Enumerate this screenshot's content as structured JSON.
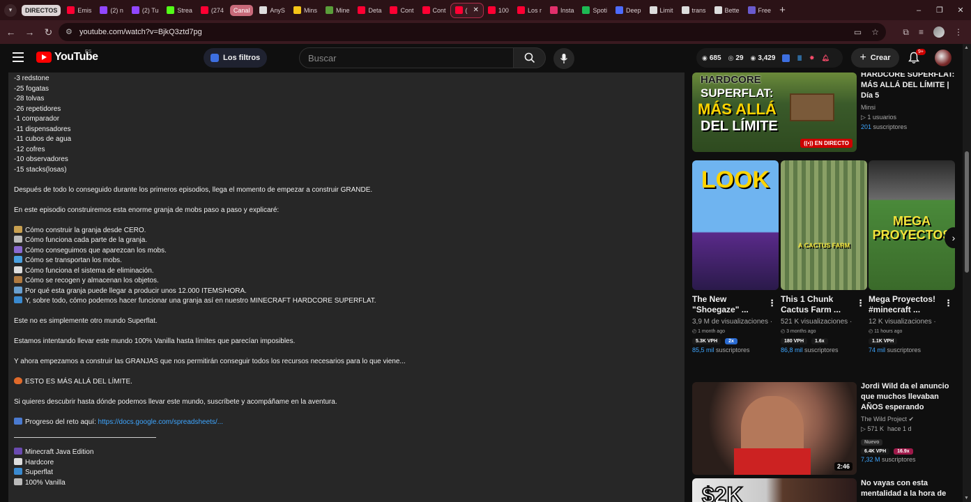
{
  "browser": {
    "tabs": [
      {
        "label": "DIRECTOS",
        "kind": "pill",
        "color": "#ddd5d6"
      },
      {
        "label": "Emis",
        "color": "#ff0033"
      },
      {
        "label": "(2) n",
        "color": "#9146ff"
      },
      {
        "label": "(2) Tu",
        "color": "#9146ff"
      },
      {
        "label": "Strea",
        "color": "#53fc18"
      },
      {
        "label": "(274",
        "color": "#ff0033"
      },
      {
        "label": "Canal",
        "kind": "pill-red",
        "color": "#c86a7a"
      },
      {
        "label": "AnyS",
        "color": "#dddddd"
      },
      {
        "label": "Mins",
        "color": "#f5c518"
      },
      {
        "label": "Mine",
        "color": "#5a9e3a"
      },
      {
        "label": "Deta",
        "color": "#ff0033"
      },
      {
        "label": "Cont",
        "color": "#ff0033"
      },
      {
        "label": "Cont",
        "color": "#ff0033"
      },
      {
        "label": "(",
        "kind": "active",
        "color": "#ff0033"
      },
      {
        "label": "100",
        "color": "#ff0033"
      },
      {
        "label": "Los r",
        "color": "#ff0033"
      },
      {
        "label": "Insta",
        "color": "#e1306c"
      },
      {
        "label": "Spoti",
        "color": "#1db954"
      },
      {
        "label": "Deep",
        "color": "#4d6bfe"
      },
      {
        "label": "Limit",
        "color": "#dddddd"
      },
      {
        "label": "trans",
        "color": "#dddddd"
      },
      {
        "label": "Bette",
        "color": "#dddddd"
      },
      {
        "label": "Free",
        "color": "#6a5acd"
      }
    ],
    "url": "youtube.com/watch?v=BjkQ3ztd7pg"
  },
  "masthead": {
    "logo": "YouTube",
    "country": "ES",
    "filters_label": "Los filtros",
    "search_placeholder": "Buscar",
    "stats": {
      "a": "685",
      "b": "29",
      "c": "3,429"
    },
    "create_label": "Crear",
    "notif_badge": "9+"
  },
  "description": {
    "lines": [
      "-3 redstone",
      "-25 fogatas",
      "-28 tolvas",
      "-26 repetidores",
      "-1 comparador",
      "-11 dispensadores",
      "-11 cubos de agua",
      "-12 cofres",
      "-10 observadores",
      "-15 stacks(losas)"
    ],
    "p1": "Después de todo lo conseguido durante los primeros episodios, llega el momento de empezar a construir GRANDE.",
    "p2": "En este episodio construiremos esta enorme granja de mobs paso a paso y explicaré:",
    "bullets": [
      {
        "emoji": "#c8a050",
        "text": "Cómo construir la granja desde CERO."
      },
      {
        "emoji": "#bbbbbb",
        "text": "Cómo funciona cada parte de la granja."
      },
      {
        "emoji": "#8a6ad0",
        "text": "Cómo conseguimos que aparezcan los mobs."
      },
      {
        "emoji": "#4aa0e0",
        "text": "Cómo se transportan los mobs."
      },
      {
        "emoji": "#dddddd",
        "text": "Cómo funciona el sistema de eliminación."
      },
      {
        "emoji": "#b07a40",
        "text": "Cómo se recogen y almacenan los objetos."
      },
      {
        "emoji": "#6aa0d0",
        "text": "Por qué esta granja puede llegar a producir unos 12.000 ITEMS/HORA."
      },
      {
        "emoji": "#3a8ad0",
        "text": "Y, sobre todo, cómo podemos hacer funcionar una granja así en nuestro MINECRAFT HARDCORE SUPERFLAT."
      }
    ],
    "p3": "Este no es simplemente otro mundo Superflat.",
    "p4": "Estamos intentando llevar este mundo 100% Vanilla hasta límites que parecían imposibles.",
    "p5": "Y ahora empezamos a construir las GRANJAS que nos permitirán conseguir todos los recursos necesarios para lo que viene...",
    "p6": "ESTO ES MÁS ALLÁ DEL LÍMITE.",
    "p7": "Si quieres descubrir hasta dónde podemos llevar este mundo, suscríbete y acompáñame en la aventura.",
    "progress_label": "Progreso del reto aquí: ",
    "progress_link": "https://docs.google.com/spreadsheets/...",
    "tags": [
      {
        "emoji": "#6a4ab0",
        "text": "Minecraft Java Edition"
      },
      {
        "emoji": "#dddddd",
        "text": "Hardcore"
      },
      {
        "emoji": "#3a8ad0",
        "text": "Superflat"
      },
      {
        "emoji": "#bbbbbb",
        "text": "100% Vanilla"
      }
    ]
  },
  "sidebar": {
    "live_video": {
      "thumb_text_1": "HARDCORE",
      "thumb_text_2": "SUPERFLAT:",
      "thumb_text_3": "MÁS ALLÁ",
      "thumb_text_4": "DEL LÍMITE",
      "title": "HARDCORE SUPERFLAT: MÁS ALLÁ DEL LÍMITE | Día 5",
      "channel": "Minsi",
      "viewers": "1 usuarios",
      "subs_num": "201",
      "subs_word": "suscriptores",
      "live_label": "EN DIRECTO"
    },
    "shorts": [
      {
        "thumb_text": "LOOK",
        "title": "The New \"Shoegaze\" ...",
        "views": "3,9 M de visualizaciones ·",
        "age": "1 month ago",
        "vph": "5.3K VPH",
        "mult": "2x",
        "subs_num": "85,5 mil",
        "subs_word": "suscriptores"
      },
      {
        "thumb_text": "A CACTUS FARM",
        "title": "This 1 Chunk Cactus Farm ...",
        "views": "521 K visualizaciones ·",
        "age": "3 months ago",
        "vph": "180 VPH",
        "mult": "1.6x",
        "subs_num": "86,8 mil",
        "subs_word": "suscriptores"
      },
      {
        "thumb_text": "MEGA PROYECTOS",
        "title": "Mega Proyectos! #minecraft ...",
        "views": "12 K visualizaciones ·",
        "age": "11 hours ago",
        "vph": "1.1K VPH",
        "mult": "",
        "subs_num": "74 mil",
        "subs_word": "suscriptores"
      }
    ],
    "video2": {
      "title": "Jordi Wild da el anuncio que muchos llevaban AÑOS esperando",
      "channel": "The Wild Project",
      "views": "571 K",
      "age": "hace 1 d",
      "badge": "Nuevo",
      "vph": "6.4K VPH",
      "mult": "16.9x",
      "subs_num": "7,32 M",
      "subs_word": "suscriptores",
      "duration": "2:46"
    },
    "video3": {
      "title": "No vayas con esta mentalidad a la hora de",
      "thumb_text": "$2K"
    }
  }
}
